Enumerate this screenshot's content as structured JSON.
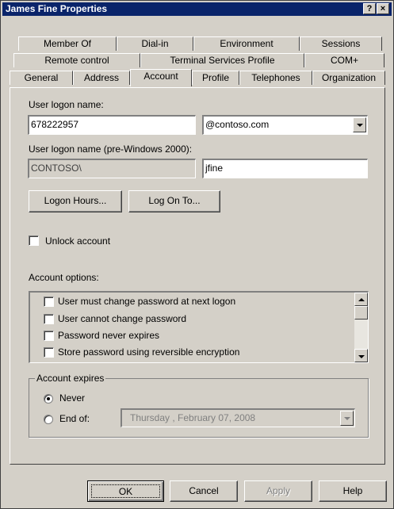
{
  "window": {
    "title": "James Fine Properties",
    "help_button": "?",
    "close_button": "×"
  },
  "tabs": {
    "row1": [
      "Member Of",
      "Dial-in",
      "Environment",
      "Sessions"
    ],
    "row2": [
      "Remote control",
      "Terminal Services Profile",
      "COM+"
    ],
    "row3": [
      "General",
      "Address",
      "Account",
      "Profile",
      "Telephones",
      "Organization"
    ],
    "active": "Account"
  },
  "account": {
    "logon_name_label": "User logon name:",
    "logon_name_value": "678222957",
    "domain_value": "@contoso.com",
    "pre2000_label": "User logon name (pre-Windows 2000):",
    "pre2000_domain": "CONTOSO\\",
    "pre2000_user": "jfine",
    "logon_hours_button": "Logon Hours...",
    "log_on_to_button": "Log On To...",
    "unlock_label": "Unlock account",
    "unlock_checked": false,
    "options_label": "Account options:",
    "options": [
      {
        "label": "User must change password at next logon",
        "checked": false
      },
      {
        "label": "User cannot change password",
        "checked": false
      },
      {
        "label": "Password never expires",
        "checked": false
      },
      {
        "label": "Store password using reversible encryption",
        "checked": false
      }
    ],
    "expires": {
      "group_label": "Account expires",
      "never_label": "Never",
      "never_selected": true,
      "end_of_label": "End of:",
      "end_of_selected": false,
      "date_value": "Thursday  ,  February  07, 2008"
    }
  },
  "buttons": {
    "ok": "OK",
    "cancel": "Cancel",
    "apply": "Apply",
    "help": "Help"
  },
  "colors": {
    "titlebar": "#0a246a",
    "face": "#d4d0c8"
  }
}
